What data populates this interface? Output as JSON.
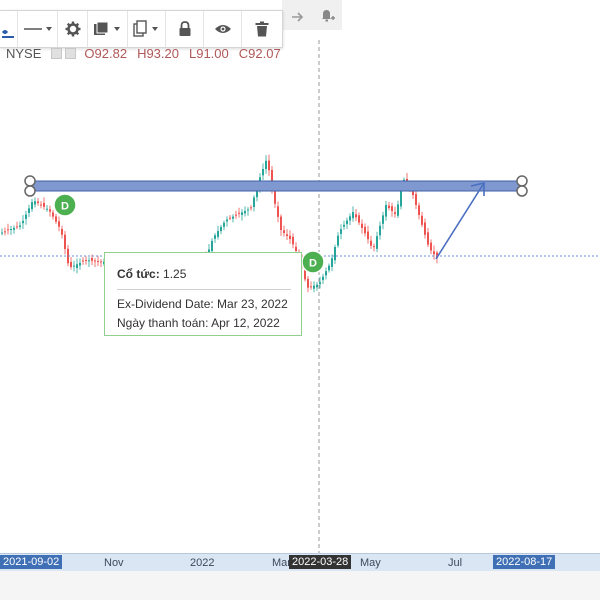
{
  "header": {
    "exchange": "NYSE",
    "ohlc": {
      "open": "O92.82",
      "high": "H93.20",
      "low": "L91.00",
      "close": "C92.07"
    }
  },
  "toolbar": {
    "items": [
      {
        "name": "brush-tool",
        "icon": "brush-icon"
      },
      {
        "name": "line-style",
        "icon": "line-style-icon"
      },
      {
        "name": "settings",
        "icon": "gear-icon"
      },
      {
        "name": "fill-color",
        "icon": "fill-icon"
      },
      {
        "name": "copy",
        "icon": "copy-icon"
      },
      {
        "name": "lock",
        "icon": "lock-icon"
      },
      {
        "name": "visibility",
        "icon": "eye-icon"
      },
      {
        "name": "delete",
        "icon": "trash-icon"
      }
    ],
    "extra": [
      "redo-arrow-icon",
      "add-alert-icon"
    ]
  },
  "dividend_marker_label": "D",
  "tooltip": {
    "dividend_label": "Cổ tức:",
    "dividend_value": "1.25",
    "ex_dividend": "Ex-Dividend Date: Mar 23, 2022",
    "payment": "Ngày thanh toán: Apr 12, 2022"
  },
  "xaxis": {
    "labels": [
      "2021-09-02",
      "Nov",
      "2022",
      "Mar",
      "2022-03-28",
      "May",
      "Jul",
      "2022-08-17"
    ]
  },
  "colors": {
    "up": "#26a69a",
    "down": "#ef5350",
    "band": "#5b7fc4",
    "dividend_badge": "#4caf50",
    "accent": "#3f6fb5"
  }
}
